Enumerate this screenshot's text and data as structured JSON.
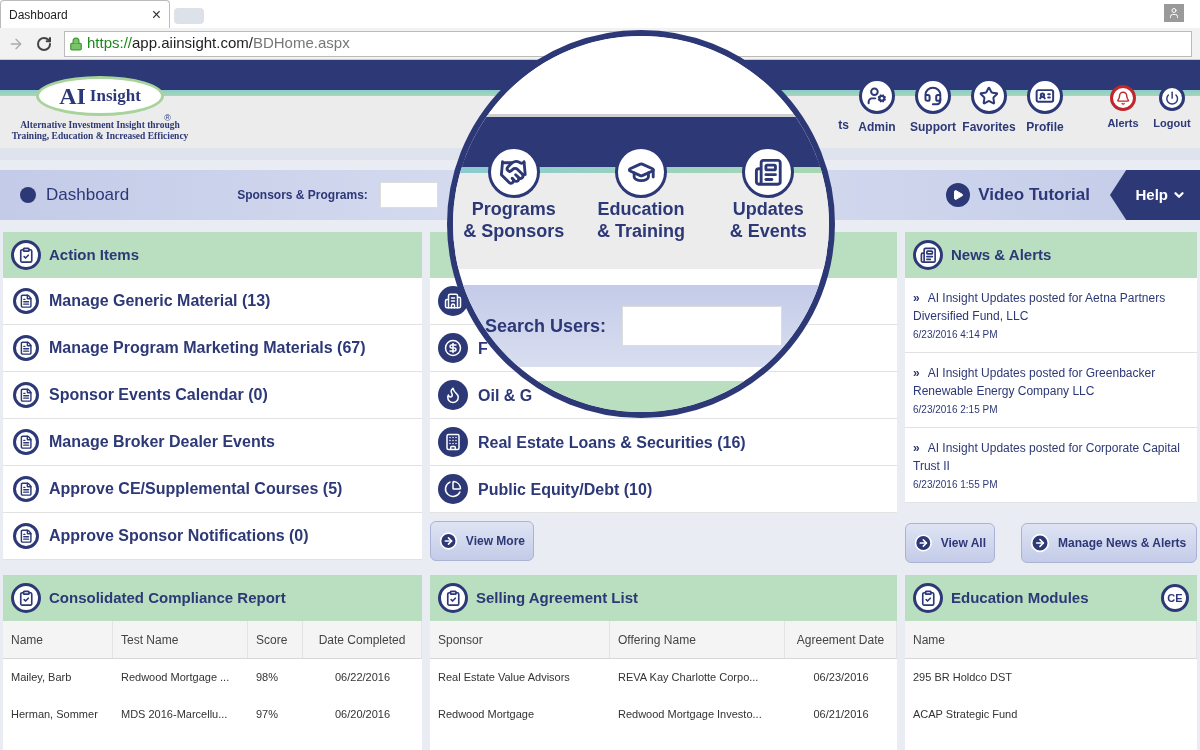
{
  "browser": {
    "tab_title": "Dashboard",
    "tab_close": "×",
    "url_scheme": "https://",
    "url_host": "app.aiinsight.com/",
    "url_path": "BDHome.aspx"
  },
  "header": {
    "logo": {
      "mark": "AI",
      "word": "Insight",
      "registered": "®",
      "tagline": [
        "Alternative Investment Insight through",
        "Training, Education & Increased Efficiency"
      ]
    },
    "nav": [
      {
        "label": "ts",
        "kind": "reports"
      },
      {
        "label": "Admin",
        "kind": "admin"
      },
      {
        "label": "Support",
        "kind": "support"
      },
      {
        "label": "Favorites",
        "kind": "favorites"
      },
      {
        "label": "Profile",
        "kind": "profile"
      },
      {
        "label": "Alerts",
        "kind": "alerts"
      },
      {
        "label": "Logout",
        "kind": "logout"
      }
    ]
  },
  "magnifier": {
    "nav": [
      {
        "lines": [
          "Programs",
          "& Sponsors"
        ],
        "kind": "handshake"
      },
      {
        "lines": [
          "Education",
          "& Training"
        ],
        "kind": "graduate"
      },
      {
        "lines": [
          "Updates",
          "& Events"
        ],
        "kind": "newspaper"
      }
    ],
    "search_label": "Search Users:"
  },
  "dashboard_bar": {
    "title": "Dashboard",
    "filter_label": "Sponsors & Programs:",
    "video_tutorial": "Video Tutorial",
    "help": "Help"
  },
  "action_items": {
    "title": "Action Items",
    "items": [
      "Manage Generic Material (13)",
      "Manage Program Marketing Materials (67)",
      "Sponsor Events Calendar (0)",
      "Manage Broker Dealer Events",
      "Approve CE/Supplemental Courses (5)",
      "Approve Sponsor Notifications (0)"
    ]
  },
  "categories": {
    "items": [
      {
        "kind": "building"
      },
      {
        "label": "F",
        "kind": "dollar"
      },
      {
        "label": "Oil & G",
        "kind": "flame"
      },
      {
        "label": "Real Estate Loans & Securities (16)",
        "kind": "realestate"
      },
      {
        "label": "Public Equity/Debt (10)",
        "kind": "pie"
      }
    ],
    "button": "View More"
  },
  "news": {
    "title": "News & Alerts",
    "items": [
      {
        "marker": "»",
        "text": "AI Insight Updates posted for Aetna Partners Diversified Fund, LLC",
        "date": "6/23/2016 4:14 PM"
      },
      {
        "marker": "»",
        "text": "AI Insight Updates posted for Greenbacker Renewable Energy Company LLC",
        "date": "6/23/2016 2:15 PM"
      },
      {
        "marker": "»",
        "text": "AI Insight Updates posted for Corporate Capital Trust II",
        "date": "6/23/2016 1:55 PM"
      }
    ],
    "buttons": [
      "View All",
      "Manage News & Alerts"
    ]
  },
  "tables": [
    {
      "title": "Consolidated Compliance Report",
      "columns": [
        "Name",
        "Test Name",
        "Score",
        "Date Completed"
      ],
      "rows": [
        [
          "Mailey, Barb",
          "Redwood Mortgage ...",
          "98%",
          "06/22/2016"
        ],
        [
          "Herman, Sommer",
          "MDS 2016-Marcellu...",
          "97%",
          "06/20/2016"
        ]
      ]
    },
    {
      "title": "Selling Agreement List",
      "columns": [
        "Sponsor",
        "Offering Name",
        "Agreement Date"
      ],
      "rows": [
        [
          "Real Estate Value Advisors",
          "REVA Kay Charlotte Corpo...",
          "06/23/2016"
        ],
        [
          "Redwood Mortgage",
          "Redwood Mortgage Investo...",
          "06/21/2016"
        ]
      ]
    },
    {
      "title": "Education Modules",
      "badge": "CE",
      "columns": [
        "Name"
      ],
      "rows": [
        [
          "295 BR Holdco DST"
        ],
        [
          "ACAP Strategic Fund"
        ]
      ]
    }
  ]
}
